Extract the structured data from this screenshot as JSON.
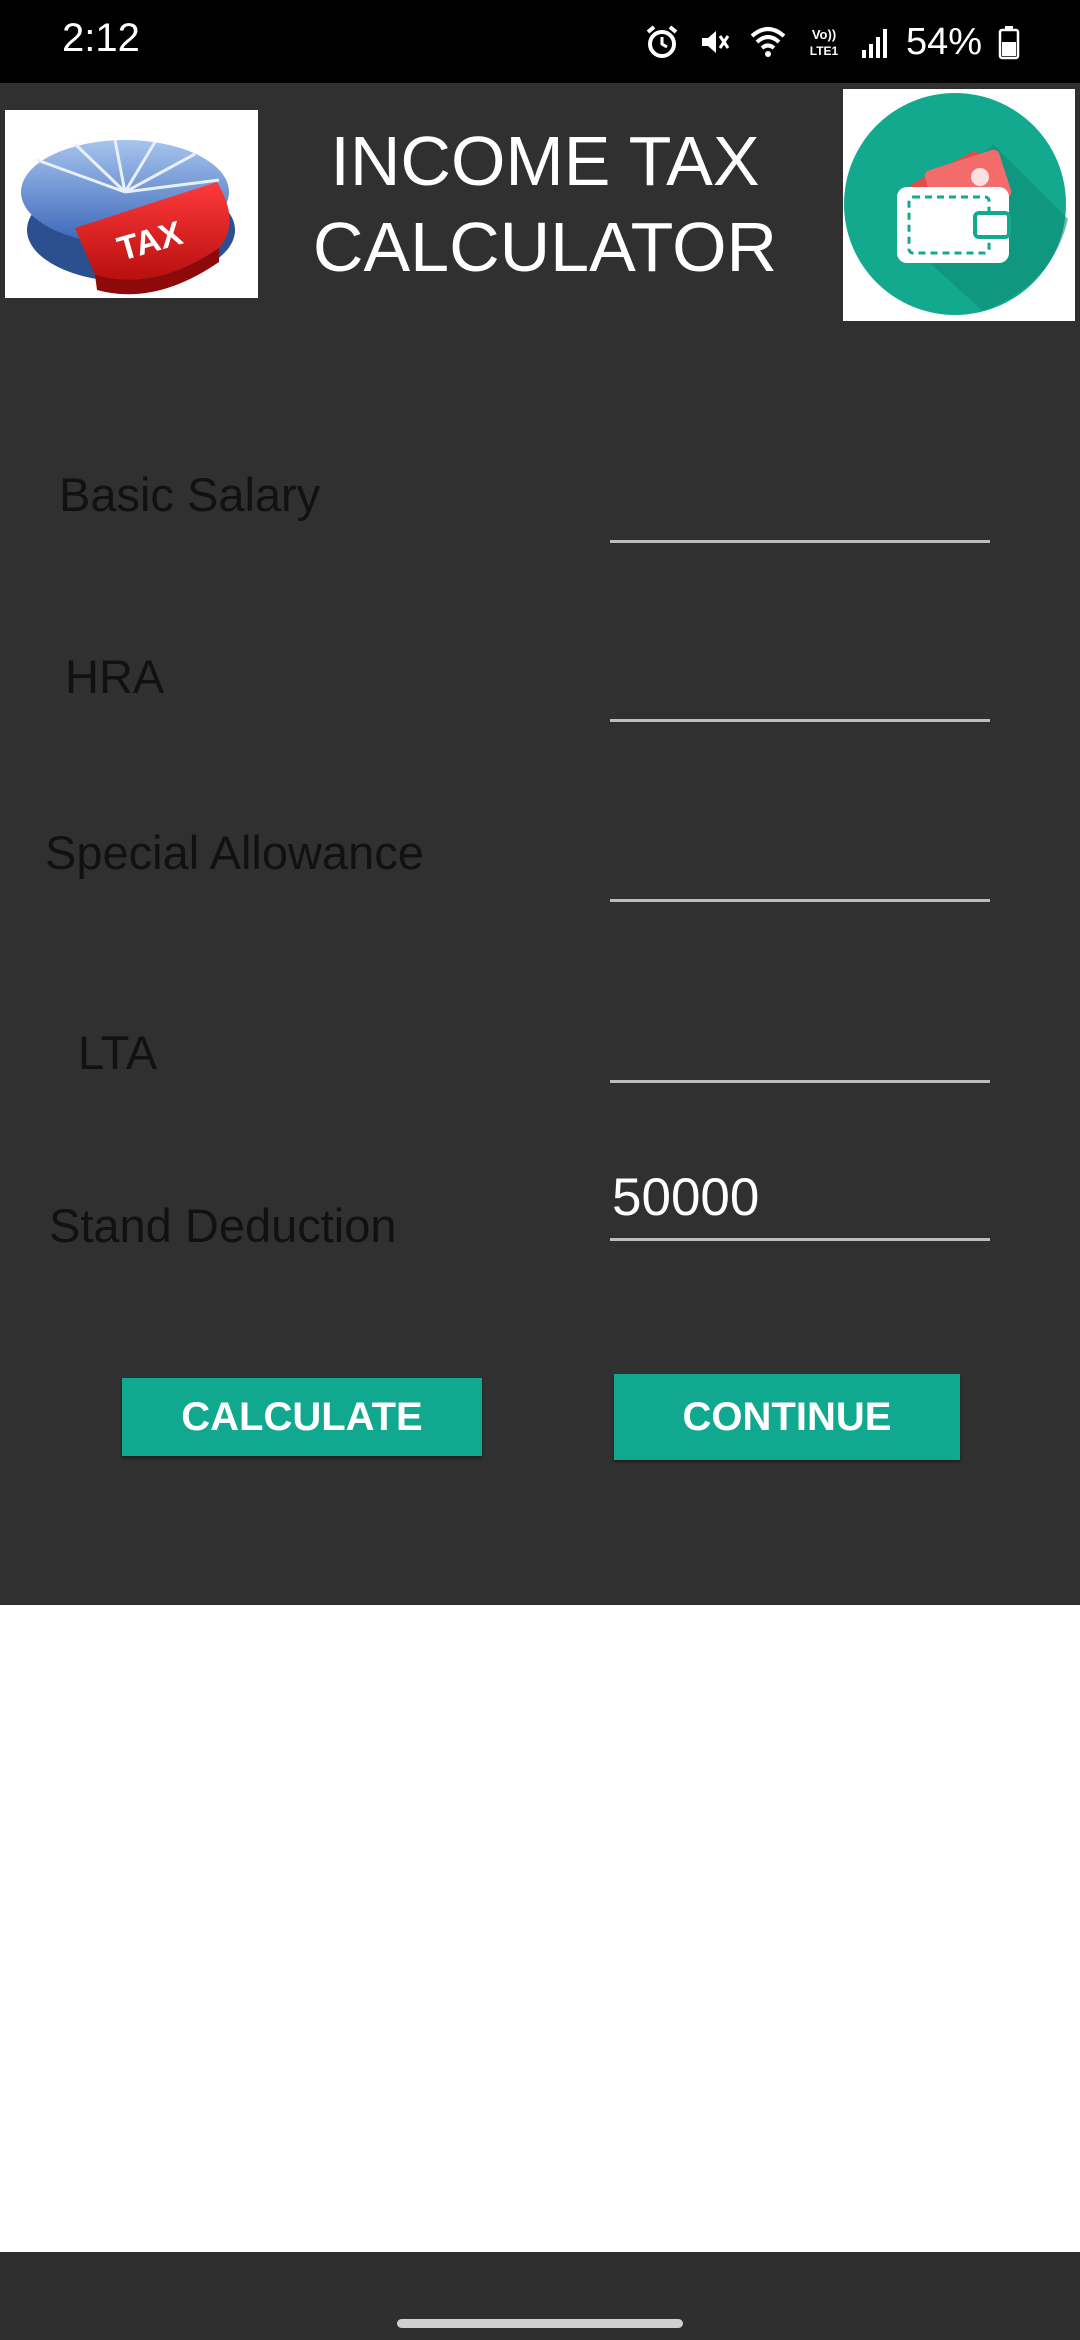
{
  "status_bar": {
    "time": "2:12",
    "battery_percent": "54%",
    "network_label": "Vo)) LTE1",
    "icons": [
      "alarm-icon",
      "mute-vibrate-icon",
      "wifi-icon",
      "volte-icon",
      "signal-icon",
      "battery-icon"
    ]
  },
  "header": {
    "title_line1": "INCOME TAX",
    "title_line2": "CALCULATOR",
    "left_logo_text": "TAX",
    "left_logo_icon": "tax-pie-chart-logo",
    "right_logo_icon": "wallet-icon"
  },
  "form": {
    "basic_salary": {
      "label": "Basic Salary",
      "value": "",
      "placeholder": ""
    },
    "hra": {
      "label": "HRA",
      "value": "",
      "placeholder": ""
    },
    "special_allowance": {
      "label": "Special Allowance",
      "value": "",
      "placeholder": ""
    },
    "lta": {
      "label": "LTA",
      "value": "",
      "placeholder": ""
    },
    "stand_deduction": {
      "label": "Stand Deduction",
      "value": "50000",
      "placeholder": ""
    }
  },
  "buttons": {
    "calculate_label": "CALCULATE",
    "continue_label": "CONTINUE"
  },
  "colors": {
    "app_background": "#303030",
    "accent": "#10a88f",
    "status_bar": "#000000",
    "wallet_circle": "#12a98e"
  }
}
